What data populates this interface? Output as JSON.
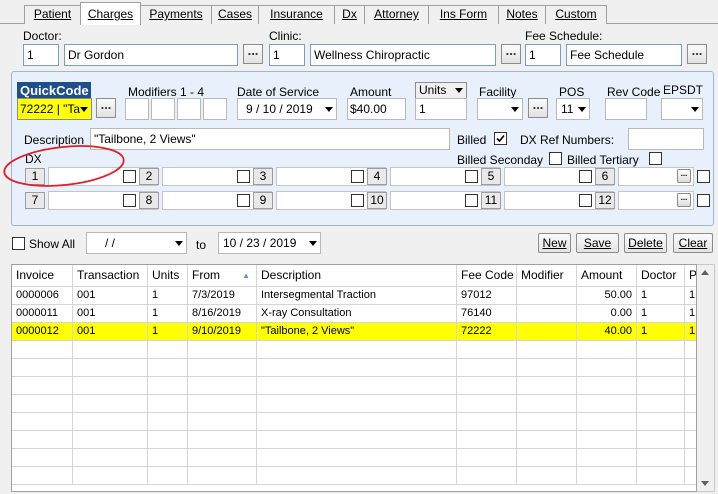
{
  "tabs": [
    "Patient",
    "Charges",
    "Payments",
    "Cases",
    "Insurance",
    "Dx",
    "Attorney",
    "Ins Form",
    "Notes",
    "Custom"
  ],
  "doctor": {
    "label": "Doctor:",
    "id": "1",
    "name": "Dr Gordon"
  },
  "clinic": {
    "label": "Clinic:",
    "id": "1",
    "name": "Wellness Chiropractic"
  },
  "fee_schedule": {
    "label": "Fee Schedule:",
    "id": "1",
    "name": "Fee Schedule"
  },
  "charge": {
    "quickcode_label": "QuickCode",
    "quickcode_value": "72222 | \"Ta",
    "modifiers_label": "Modifiers 1 - 4",
    "dos_label": "Date of Service",
    "dos_value": "9 / 10 / 2019",
    "amount_label": "Amount",
    "amount_value": "$40.00",
    "units_label": "Units",
    "units_value": "1",
    "facility_label": "Facility",
    "pos_label": "POS",
    "pos_value": "11",
    "rev_code_label": "Rev Code",
    "epsdt_label": "EPSDT",
    "description_label": "Description",
    "description_value": "\"Tailbone, 2 Views\"",
    "billed_label": "Billed",
    "dx_ref_label": "DX Ref Numbers:",
    "billed_secondary_label": "Billed Seconday",
    "billed_tertiary_label": "Billed Tertiary",
    "dx_label": "DX",
    "dx_numbers": [
      "1",
      "2",
      "3",
      "4",
      "5",
      "6",
      "7",
      "8",
      "9",
      "10",
      "11",
      "12"
    ]
  },
  "filter": {
    "show_all_label": "Show All",
    "from_date": "/      /",
    "to_label": "to",
    "to_date": "10 / 23 / 2019"
  },
  "buttons": {
    "new": "New",
    "save": "Save",
    "delete": "Delete",
    "clear": "Clear"
  },
  "table": {
    "columns": [
      "Invoice",
      "Transaction",
      "Units",
      "From",
      "Description",
      "Fee Code",
      "Modifier",
      "Amount",
      "Doctor",
      "P"
    ],
    "rows": [
      [
        "0000006",
        "001",
        "1",
        "7/3/2019",
        "Intersegmental Traction",
        "97012",
        "",
        "50.00",
        "1",
        "1"
      ],
      [
        "0000011",
        "001",
        "1",
        "8/16/2019",
        "X-ray Consultation",
        "76140",
        "",
        "0.00",
        "1",
        "1"
      ],
      [
        "0000012",
        "001",
        "1",
        "9/10/2019",
        "\"Tailbone, 2 Views\"",
        "72222",
        "",
        "40.00",
        "1",
        "1"
      ]
    ],
    "selected_row": 2,
    "highlight_color": "#ffff00"
  },
  "annotation_color": "#e0202a"
}
